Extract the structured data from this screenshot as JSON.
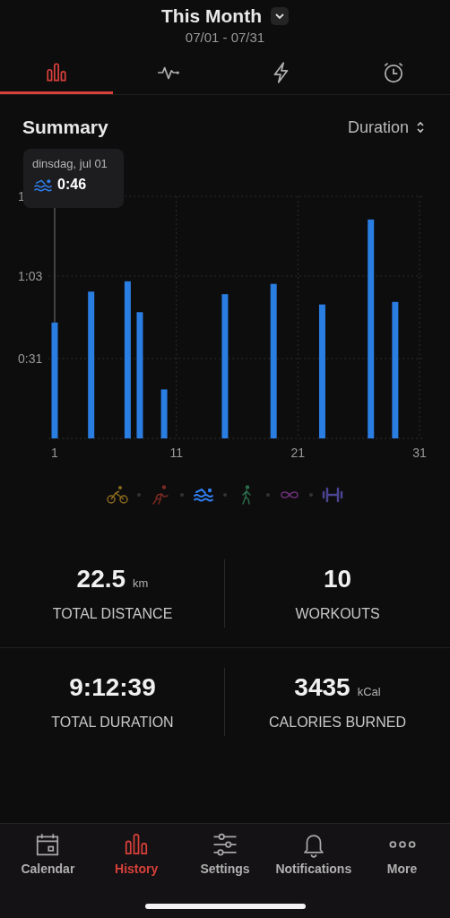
{
  "header": {
    "title": "This Month",
    "date_range": "07/01 - 07/31"
  },
  "tabs": [
    {
      "kind": "bars",
      "selected": true
    },
    {
      "kind": "pulse",
      "selected": false
    },
    {
      "kind": "bolt",
      "selected": false
    },
    {
      "kind": "alarm",
      "selected": false
    }
  ],
  "summary": {
    "title": "Summary",
    "metric": "Duration",
    "tooltip": {
      "kind": "swimming",
      "date": "dinsdag, jul 01",
      "value": "0:46"
    },
    "chart_data": {
      "type": "bar",
      "x": [
        1,
        4,
        7,
        8,
        10,
        15,
        19,
        23,
        27,
        29
      ],
      "series": [
        {
          "color": "#2a7de1",
          "values": [
            45,
            57,
            61,
            49,
            19,
            56,
            60,
            52,
            85,
            53
          ]
        }
      ],
      "xlim": [
        0.5,
        31.3
      ],
      "ylim": [
        0,
        94
      ],
      "xticks": [
        1,
        11,
        21,
        31
      ],
      "grid": true,
      "yticks": [
        {
          "value": 31,
          "label": "0:31"
        },
        {
          "value": 63,
          "label": "1:03"
        }
      ]
    },
    "top_axis_label_part": "1"
  },
  "activities": [
    {
      "kind": "cycling",
      "color": "#8a6a1e",
      "selected": false
    },
    {
      "kind": "running",
      "color": "#7a2a22",
      "selected": false
    },
    {
      "kind": "swimming",
      "color": "#2f7ff0",
      "selected": true
    },
    {
      "kind": "walking",
      "color": "#2b6b4a",
      "selected": false
    },
    {
      "kind": "other",
      "color": "#6b2f78",
      "selected": false
    },
    {
      "kind": "strength",
      "color": "#4a4390",
      "selected": false
    }
  ],
  "stats": [
    {
      "value": "22.5",
      "unit": "km",
      "label": "TOTAL DISTANCE"
    },
    {
      "value": "10",
      "label": "WORKOUTS"
    },
    {
      "value": "9:12:39",
      "label": "TOTAL DURATION"
    },
    {
      "value": "3435",
      "unit": "kCal",
      "label": "CALORIES BURNED"
    }
  ],
  "nav": [
    {
      "kind": "calendar",
      "label": "Calendar",
      "selected": false
    },
    {
      "kind": "bars",
      "label": "History",
      "selected": true
    },
    {
      "kind": "sliders",
      "label": "Settings",
      "selected": false
    },
    {
      "kind": "bell",
      "label": "Notifications",
      "selected": false
    },
    {
      "kind": "dots",
      "label": "More",
      "selected": false
    }
  ]
}
